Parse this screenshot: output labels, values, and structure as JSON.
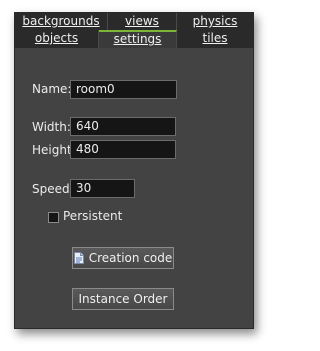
{
  "tabs": {
    "row1": [
      {
        "label": "backgrounds"
      },
      {
        "label": "views"
      },
      {
        "label": "physics"
      }
    ],
    "row2": [
      {
        "label": "objects"
      },
      {
        "label": "settings",
        "active": true
      },
      {
        "label": "tiles"
      }
    ]
  },
  "form": {
    "name_label": "Name:",
    "name_value": "room0",
    "width_label": "Width:",
    "width_value": "640",
    "height_label": "Height:",
    "height_value": "480",
    "speed_label": "Speed:",
    "speed_value": "30",
    "persistent_label": "Persistent",
    "persistent_checked": false
  },
  "buttons": {
    "creation_code": "Creation code",
    "instance_order": "Instance Order"
  },
  "colors": {
    "panel_bg": "#434343",
    "field_bg": "#151515",
    "active_tab_accent": "#7db53a"
  }
}
